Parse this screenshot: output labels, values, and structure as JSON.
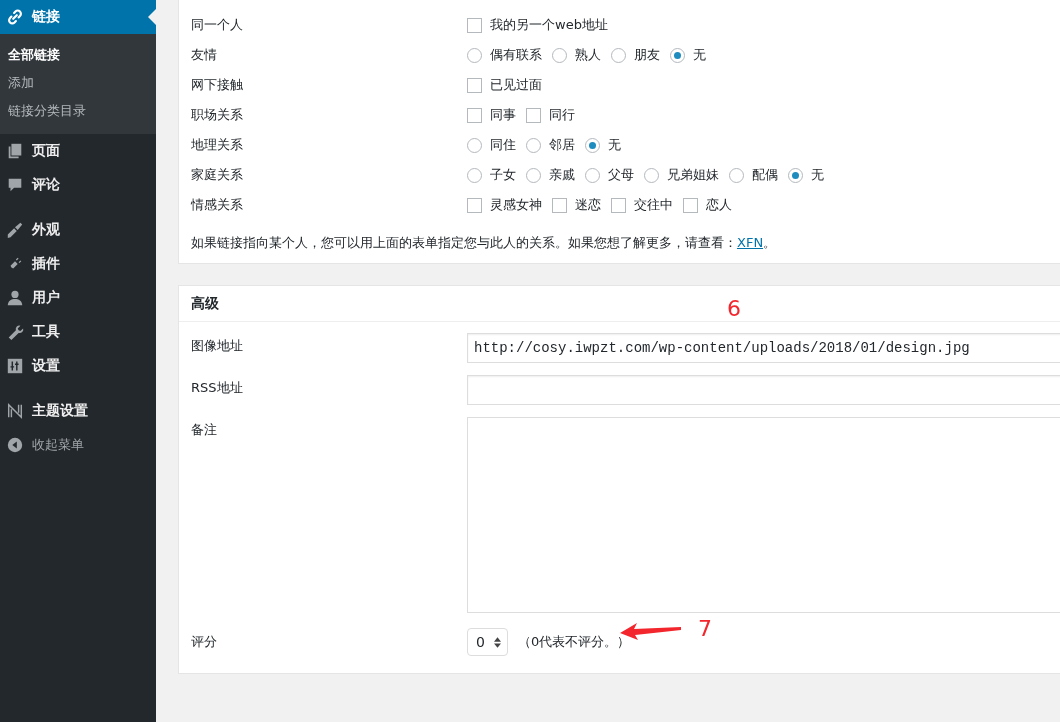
{
  "sidebar": {
    "menu_groups": [
      [
        {
          "label": "链接",
          "selected": true,
          "children": [
            {
              "label": "全部链接",
              "selected": true
            },
            {
              "label": "添加",
              "selected": false
            },
            {
              "label": "链接分类目录",
              "selected": false
            }
          ]
        },
        {
          "label": "页面",
          "selected": false
        },
        {
          "label": "评论",
          "selected": false
        }
      ],
      [
        {
          "label": "外观",
          "selected": false
        },
        {
          "label": "插件",
          "selected": false
        },
        {
          "label": "用户",
          "selected": false
        },
        {
          "label": "工具",
          "selected": false
        },
        {
          "label": "设置",
          "selected": false
        }
      ],
      [
        {
          "label": "主题设置",
          "selected": false
        }
      ]
    ],
    "collapse_label": "收起菜单"
  },
  "xfn": {
    "rows": [
      {
        "label": "同一个人",
        "kind": "checkbox",
        "options": [
          {
            "label": "我的另一个web地址",
            "checked": false
          }
        ]
      },
      {
        "label": "友情",
        "kind": "radio",
        "options": [
          {
            "label": "偶有联系",
            "selected": false
          },
          {
            "label": "熟人",
            "selected": false
          },
          {
            "label": "朋友",
            "selected": false
          },
          {
            "label": "无",
            "selected": true
          }
        ]
      },
      {
        "label": "网下接触",
        "kind": "checkbox",
        "options": [
          {
            "label": "已见过面",
            "checked": false
          }
        ]
      },
      {
        "label": "职场关系",
        "kind": "checkbox",
        "options": [
          {
            "label": "同事",
            "checked": false
          },
          {
            "label": "同行",
            "checked": false
          }
        ]
      },
      {
        "label": "地理关系",
        "kind": "radio",
        "options": [
          {
            "label": "同住",
            "selected": false
          },
          {
            "label": "邻居",
            "selected": false
          },
          {
            "label": "无",
            "selected": true
          }
        ]
      },
      {
        "label": "家庭关系",
        "kind": "radio",
        "options": [
          {
            "label": "子女",
            "selected": false
          },
          {
            "label": "亲戚",
            "selected": false
          },
          {
            "label": "父母",
            "selected": false
          },
          {
            "label": "兄弟姐妹",
            "selected": false
          },
          {
            "label": "配偶",
            "selected": false
          },
          {
            "label": "无",
            "selected": true
          }
        ]
      },
      {
        "label": "情感关系",
        "kind": "checkbox",
        "options": [
          {
            "label": "灵感女神",
            "checked": false
          },
          {
            "label": "迷恋",
            "checked": false
          },
          {
            "label": "交往中",
            "checked": false
          },
          {
            "label": "恋人",
            "checked": false
          }
        ]
      }
    ],
    "note": {
      "text": "如果链接指向某个人，您可以用上面的表单指定您与此人的关系。如果您想了解更多，请查看：",
      "link": "XFN",
      "after": "。"
    }
  },
  "advanced": {
    "title": "高级",
    "image_url": {
      "label": "图像地址",
      "value": "http://cosy.iwpzt.com/wp-content/uploads/2018/01/design.jpg"
    },
    "rss": {
      "label": "RSS地址"
    },
    "notes": {
      "label": "备注"
    },
    "rating": {
      "label": "评分",
      "value": "0",
      "hint": "（0代表不评分。）"
    }
  },
  "annotations": [
    {
      "text": "6"
    },
    {
      "text": "7"
    }
  ]
}
